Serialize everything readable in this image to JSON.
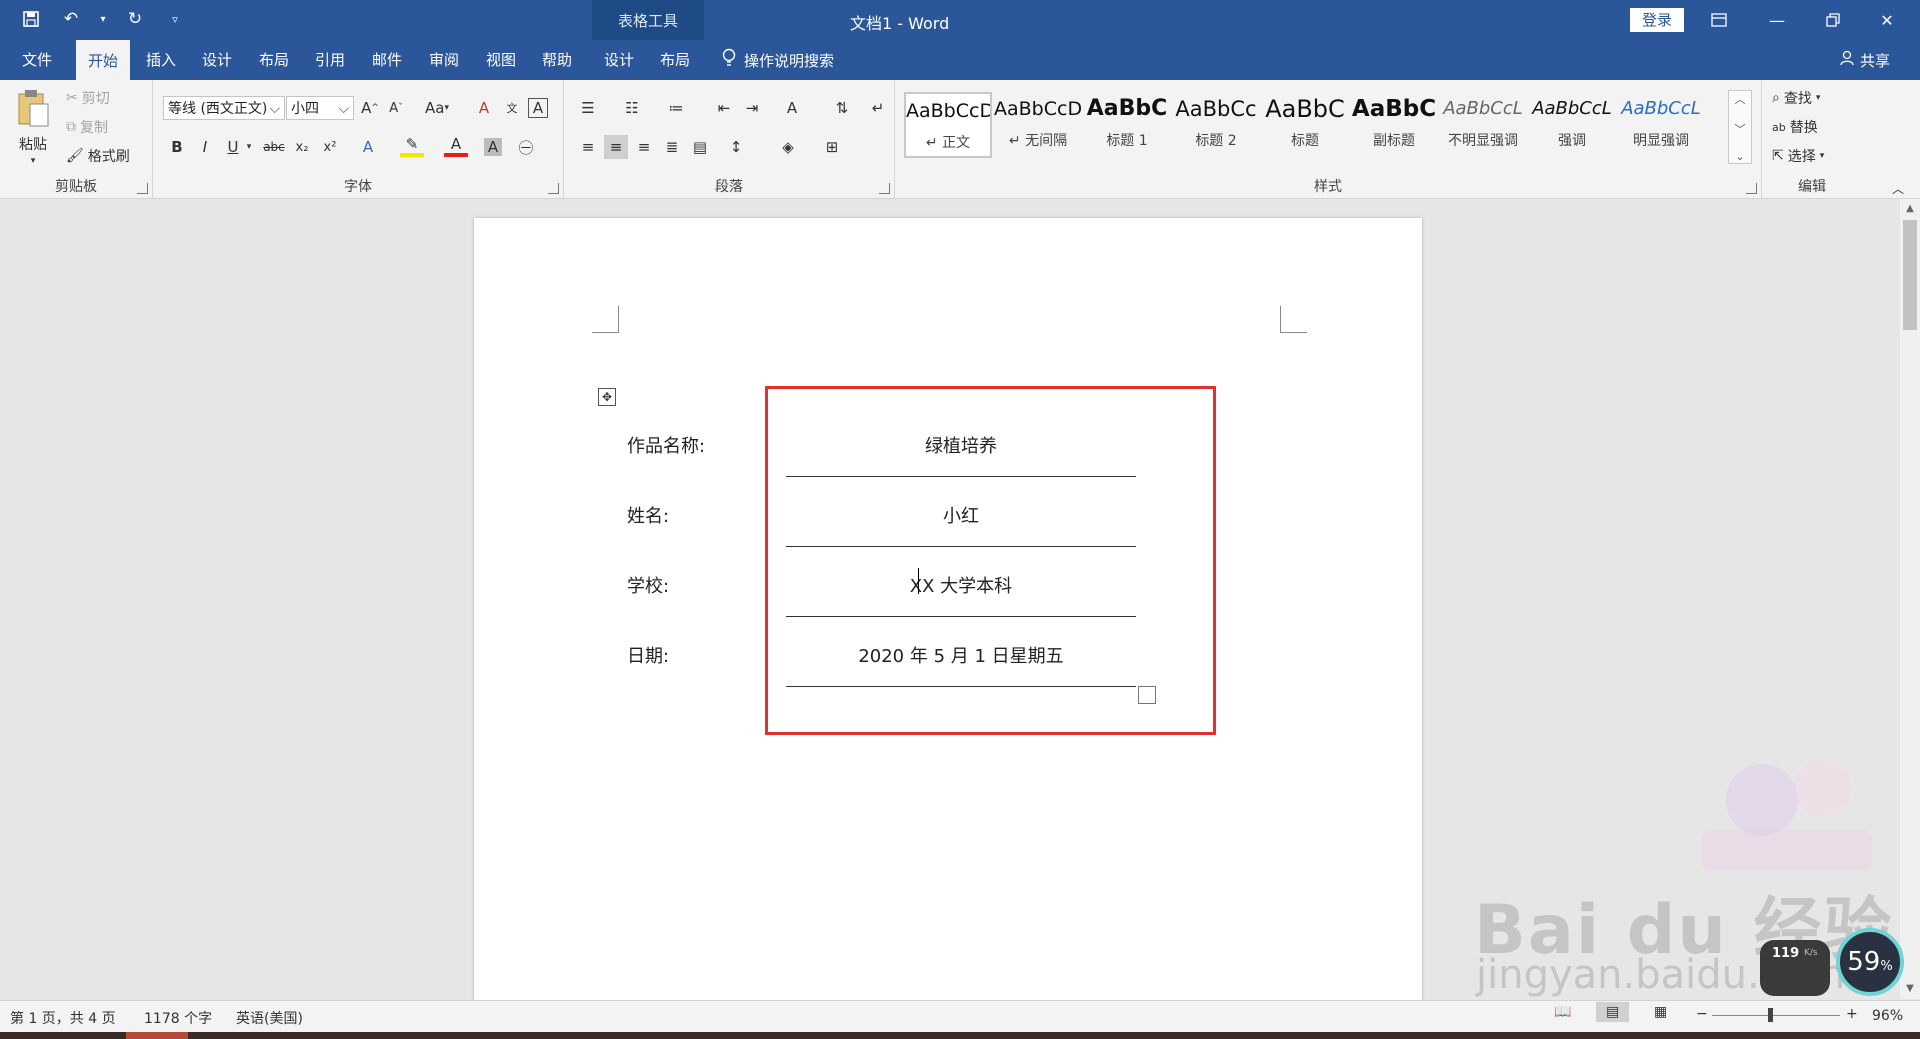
{
  "app": {
    "doc_title": "文档1  -  Word",
    "contextual_tab_label": "表格工具",
    "login_label": "登录",
    "share_label": "共享",
    "tell_me": "操作说明搜索"
  },
  "tabs": [
    "文件",
    "开始",
    "插入",
    "设计",
    "布局",
    "引用",
    "邮件",
    "审阅",
    "视图",
    "帮助",
    "设计",
    "布局"
  ],
  "active_tab": "开始",
  "ribbon": {
    "clipboard": {
      "paste": "粘贴",
      "cut": "剪切",
      "copy": "复制",
      "format_painter": "格式刷",
      "label": "剪贴板"
    },
    "font": {
      "font_name": "等线 (西文正文)",
      "font_size": "小四",
      "change_case": "Aa",
      "label": "字体"
    },
    "paragraph": {
      "label": "段落"
    },
    "styles": {
      "label": "样式",
      "items": [
        {
          "preview": "AaBbCcD",
          "name": "↵ 正文"
        },
        {
          "preview": "AaBbCcD",
          "name": "↵ 无间隔"
        },
        {
          "preview": "AaBbC",
          "name": "标题 1"
        },
        {
          "preview": "AaBbCc",
          "name": "标题 2"
        },
        {
          "preview": "AaBbC",
          "name": "标题"
        },
        {
          "preview": "AaBbC",
          "name": "副标题"
        },
        {
          "preview": "AaBbCcL",
          "name": "不明显强调"
        },
        {
          "preview": "AaBbCcL",
          "name": "强调"
        },
        {
          "preview": "AaBbCcL",
          "name": "明显强调"
        }
      ]
    },
    "editing": {
      "find": "查找",
      "replace": "替换",
      "select": "选择",
      "label": "编辑"
    }
  },
  "document": {
    "rows": [
      {
        "label": "作品名称:",
        "value": "绿植培养"
      },
      {
        "label": "姓名:",
        "value": "小红"
      },
      {
        "label": "学校:",
        "value": "XX 大学本科"
      },
      {
        "label": "日期:",
        "value": "2020 年 5 月 1 日星期五"
      }
    ]
  },
  "status": {
    "page": "第 1 页，共 4 页",
    "words": "1178 个字",
    "language": "英语(美国)",
    "zoom": "96%"
  },
  "overlay": {
    "watermark_main": "Bai  du 经验",
    "watermark_sub": "jingyan.baidu.com",
    "net_speed": "119",
    "net_unit": "K/s",
    "cpu_percent": "59",
    "cpu_unit": "%"
  },
  "colors": {
    "ribbon_blue": "#2b579a",
    "highlight_box": "#e03030"
  }
}
